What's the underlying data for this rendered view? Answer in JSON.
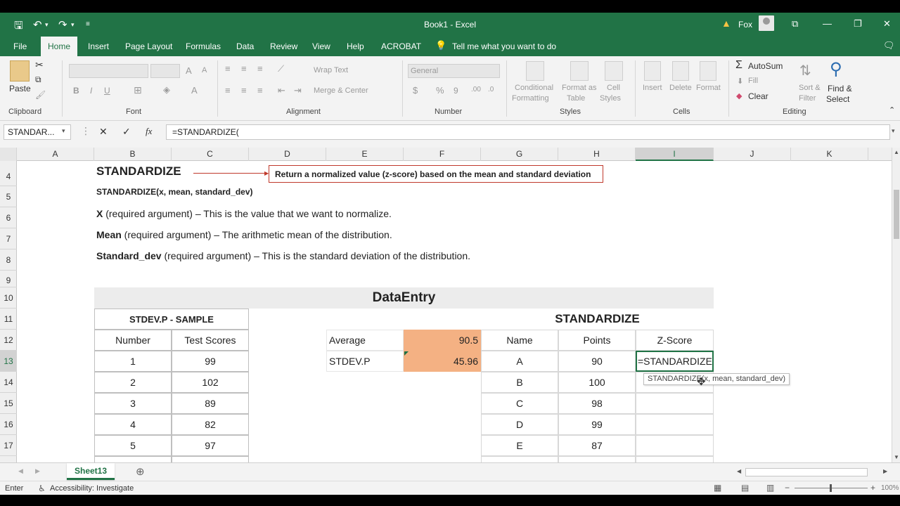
{
  "titlebar": {
    "title": "Book1  -  Excel",
    "user": "Fox",
    "warning_icon": "warning-icon"
  },
  "tabs": [
    "File",
    "Home",
    "Insert",
    "Page Layout",
    "Formulas",
    "Data",
    "Review",
    "View",
    "Help",
    "ACROBAT"
  ],
  "tell_me": "Tell me what you want to do",
  "ribbon": {
    "clipboard": {
      "label": "Clipboard",
      "paste": "Paste"
    },
    "font": {
      "label": "Font"
    },
    "alignment": {
      "label": "Alignment",
      "wrap": "Wrap Text",
      "merge": "Merge & Center"
    },
    "number": {
      "label": "Number",
      "format": "General"
    },
    "styles": {
      "label": "Styles",
      "cond1": "Conditional",
      "cond2": "Formatting",
      "fmt1": "Format as",
      "fmt2": "Table",
      "cell1": "Cell",
      "cell2": "Styles"
    },
    "cells": {
      "label": "Cells",
      "insert": "Insert",
      "delete": "Delete",
      "format": "Format"
    },
    "editing": {
      "label": "Editing",
      "autosum": "AutoSum",
      "fill": "Fill",
      "clear": "Clear",
      "sort1": "Sort &",
      "sort2": "Filter",
      "find1": "Find &",
      "find2": "Select"
    }
  },
  "formula_bar": {
    "name_box": "STANDAR...",
    "formula": "=STANDARDIZE("
  },
  "columns": [
    "A",
    "B",
    "C",
    "D",
    "E",
    "F",
    "G",
    "H",
    "I",
    "J",
    "K"
  ],
  "rows": [
    "4",
    "5",
    "6",
    "7",
    "8",
    "9",
    "10",
    "11",
    "12",
    "13",
    "14",
    "15",
    "16",
    "17"
  ],
  "content": {
    "heading": "STANDARDIZE",
    "callout": "Return a normalized value (z-score) based on the mean and standard deviation",
    "syntax": "STANDARDIZE(x, mean, standard_dev)",
    "arg_x_bold": "X",
    "arg_x_rest": " (required argument) – This is the value that we want to normalize.",
    "arg_mean_bold": "Mean",
    "arg_mean_rest": " (required argument) – The arithmetic mean of the distribution.",
    "arg_sd_bold": "Standard_dev",
    "arg_sd_rest": " (required argument) – This is the standard deviation of the distribution.",
    "banner": "DataEntry",
    "left_title": "STDEV.P - SAMPLE",
    "left_headers": [
      "Number",
      "Test Scores"
    ],
    "left_rows": [
      [
        "1",
        "99"
      ],
      [
        "2",
        "102"
      ],
      [
        "3",
        "89"
      ],
      [
        "4",
        "82"
      ],
      [
        "5",
        "97"
      ]
    ],
    "stats": [
      [
        "Average",
        "90.5"
      ],
      [
        "STDEV.P",
        "45.96"
      ]
    ],
    "right_title": "STANDARDIZE",
    "right_headers": [
      "Name",
      "Points",
      "Z-Score"
    ],
    "right_rows": [
      [
        "A",
        "90",
        "=STANDARDIZE("
      ],
      [
        "B",
        "100",
        ""
      ],
      [
        "C",
        "98",
        ""
      ],
      [
        "D",
        "99",
        ""
      ],
      [
        "E",
        "87",
        ""
      ]
    ],
    "tooltip": "STANDARDIZE(x, mean, standard_dev)"
  },
  "sheet_tab": "Sheet13",
  "status": {
    "mode": "Enter",
    "accessibility": "Accessibility: Investigate",
    "zoom": "100%"
  },
  "colors": {
    "excel_green": "#217346",
    "orange_fill": "#f4b183",
    "callout_red": "#c0392b"
  }
}
